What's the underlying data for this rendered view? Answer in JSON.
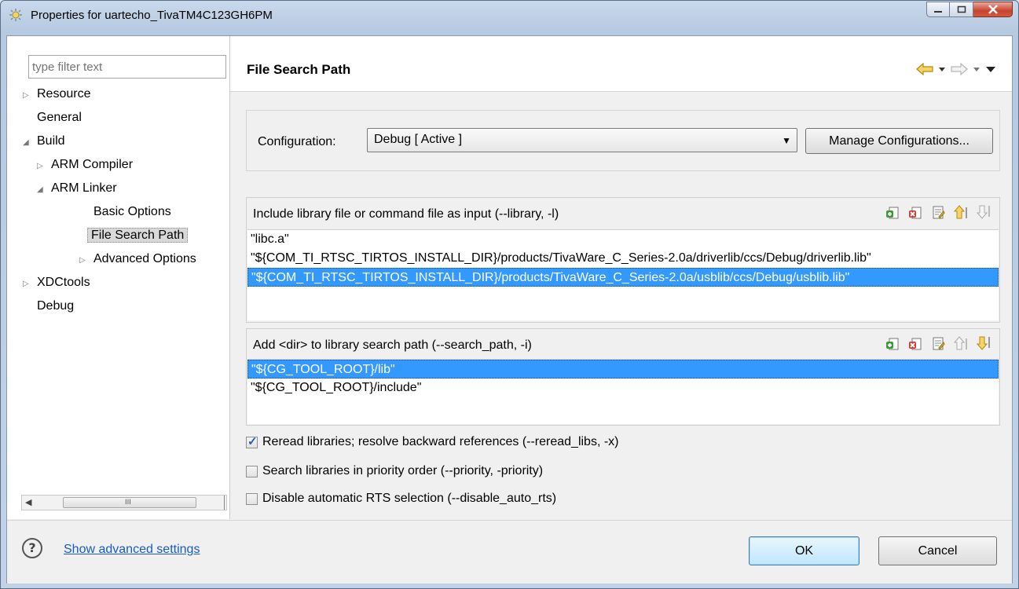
{
  "window": {
    "title": "Properties for uartecho_TivaTM4C123GH6PM"
  },
  "filter": {
    "placeholder": "type filter text"
  },
  "tree": {
    "resource": "Resource",
    "general": "General",
    "build": "Build",
    "arm_compiler": "ARM Compiler",
    "arm_linker": "ARM Linker",
    "basic_options": "Basic Options",
    "file_search_path": "File Search Path",
    "advanced_options": "Advanced Options",
    "xdctools": "XDCtools",
    "debug": "Debug",
    "scroll_grip": "III"
  },
  "page": {
    "title": "File Search Path"
  },
  "config": {
    "label": "Configuration:",
    "value": "Debug  [ Active ]",
    "manage_label": "Manage Configurations..."
  },
  "libraries": {
    "header": "Include library file or command file as input (--library, -l)",
    "items": [
      "\"libc.a\"",
      "\"${COM_TI_RTSC_TIRTOS_INSTALL_DIR}/products/TivaWare_C_Series-2.0a/driverlib/ccs/Debug/driverlib.lib\"",
      "\"${COM_TI_RTSC_TIRTOS_INSTALL_DIR}/products/TivaWare_C_Series-2.0a/usblib/ccs/Debug/usblib.lib\""
    ]
  },
  "search_paths": {
    "header": "Add <dir> to library search path (--search_path, -i)",
    "items": [
      "\"${CG_TOOL_ROOT}/lib\"",
      "\"${CG_TOOL_ROOT}/include\""
    ]
  },
  "options": {
    "reread": "Reread libraries; resolve backward references (--reread_libs, -x)",
    "priority": "Search libraries in priority order (--priority, -priority)",
    "disable_rts": "Disable automatic RTS selection (--disable_auto_rts)"
  },
  "bottom": {
    "advanced_link": "Show advanced settings",
    "ok": "OK",
    "cancel": "Cancel"
  },
  "colors": {
    "selection": "#3399ff",
    "link": "#1a5bbf",
    "title_bar": "#c2d3e7"
  }
}
